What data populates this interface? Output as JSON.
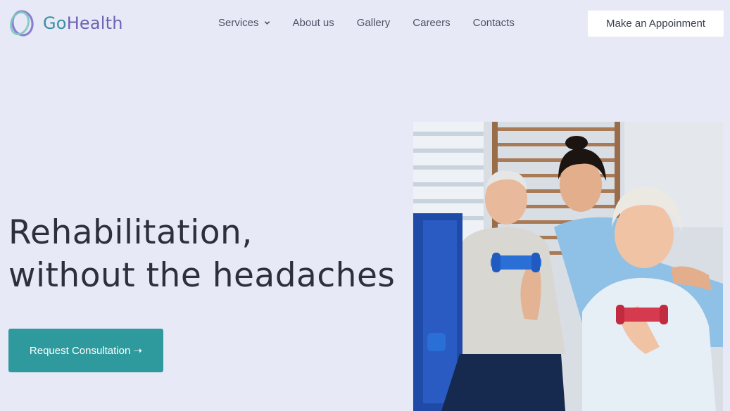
{
  "brand": {
    "name_part1": "Go",
    "name_part2": "Health"
  },
  "nav": {
    "items": [
      {
        "label": "Services",
        "has_dropdown": true
      },
      {
        "label": "About us"
      },
      {
        "label": "Gallery"
      },
      {
        "label": "Careers"
      },
      {
        "label": "Contacts"
      }
    ]
  },
  "header_cta": {
    "label": "Make an Appoinment"
  },
  "hero": {
    "title_line1": "Rehabilitation,",
    "title_line2": "without the headaches",
    "button_label": "Request Consultation ➝"
  },
  "colors": {
    "background": "#e8e9f7",
    "accent_teal": "#2f9a9d",
    "logo_purple": "#6d63b5",
    "text_dark": "#2d2f3b"
  }
}
